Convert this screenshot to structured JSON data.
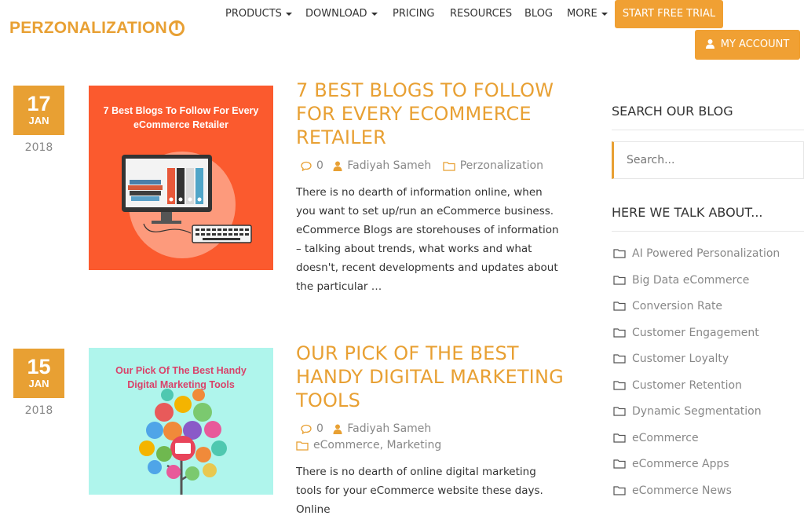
{
  "brand": {
    "logo_text": "PERZONALIZATION",
    "accent": "#e8a033"
  },
  "nav": {
    "items": [
      {
        "label": "PRODUCTS",
        "dropdown": true
      },
      {
        "label": "DOWNLOAD",
        "dropdown": true
      },
      {
        "label": "PRICING",
        "dropdown": false
      },
      {
        "label": "RESOURCES",
        "dropdown": false
      },
      {
        "label": "BLOG",
        "dropdown": false
      },
      {
        "label": "MORE",
        "dropdown": true
      }
    ],
    "trial_label": "START FREE TRIAL",
    "account_label": "MY ACCOUNT"
  },
  "posts": [
    {
      "day": "17",
      "month": "JAN",
      "year": "2018",
      "thumb_text": "7 Best Blogs To Follow For Every eCommerce Retailer",
      "title": "7 BEST BLOGS TO FOLLOW FOR EVERY ECOMMERCE RETAILER",
      "comments": "0",
      "author": "Fadiyah Sameh",
      "categories": "Perzonalization",
      "excerpt": "There is no dearth of information online, when you want to set up/run an eCommerce business. eCommerce Blogs are storehouses of information – talking about trends, what works and what doesn't, recent developments and updates about the particular …"
    },
    {
      "day": "15",
      "month": "JAN",
      "year": "2018",
      "thumb_text": "Our Pick Of The Best Handy Digital Marketing Tools",
      "title": "OUR PICK OF THE BEST HANDY DIGITAL MARKETING TOOLS",
      "comments": "0",
      "author": "Fadiyah Sameh",
      "categories": "eCommerce, Marketing",
      "excerpt": "There is no dearth of online digital marketing tools for your eCommerce website these days. Online"
    }
  ],
  "sidebar": {
    "search_heading": "SEARCH OUR BLOG",
    "search_placeholder": "Search...",
    "topics_heading": "HERE WE TALK ABOUT...",
    "categories": [
      "AI Powered Personalization",
      "Big Data eCommerce",
      "Conversion Rate",
      "Customer Engagement",
      "Customer Loyalty",
      "Customer Retention",
      "Dynamic Segmentation",
      "eCommerce",
      "eCommerce Apps",
      "eCommerce News"
    ]
  }
}
